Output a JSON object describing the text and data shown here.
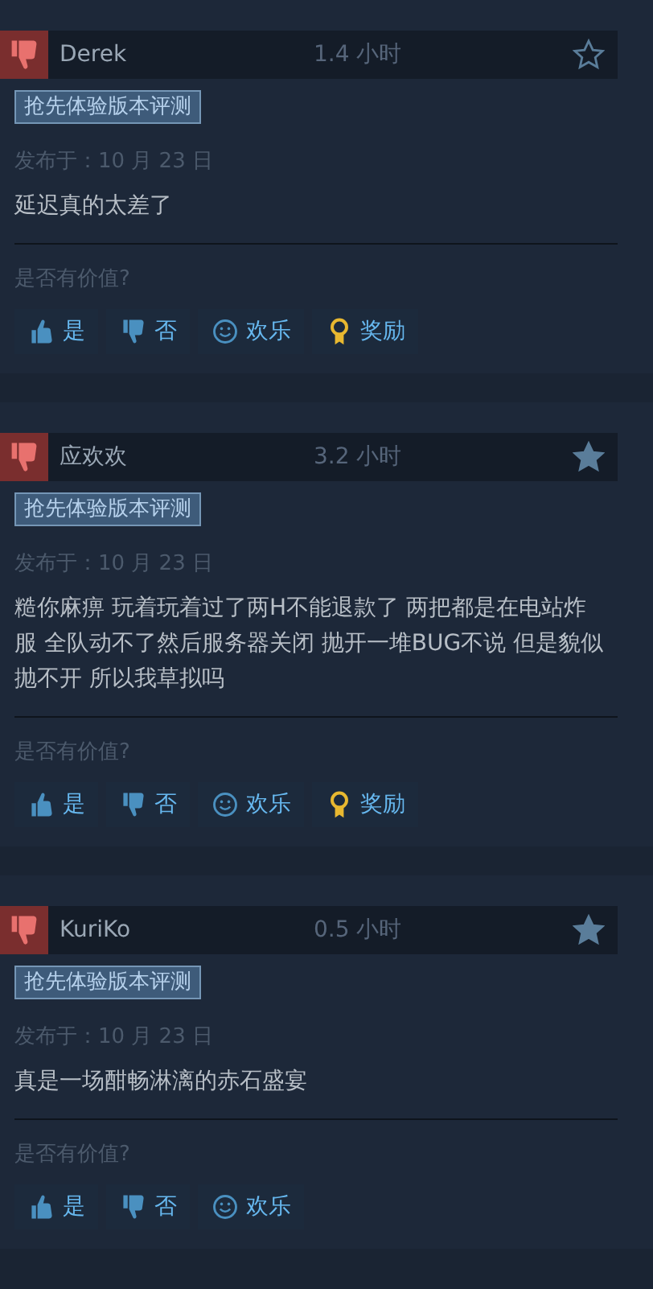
{
  "reviews": [
    {
      "author": "Derek",
      "hours": "1.4 小时",
      "favorited": false,
      "tag": "抢先体验版本评测",
      "posted": "发布于：10 月 23 日",
      "text": "延迟真的太差了",
      "helpful_prompt": "是否有价值?",
      "buttons": [
        {
          "kind": "yes",
          "label": "是"
        },
        {
          "kind": "no",
          "label": "否"
        },
        {
          "kind": "funny",
          "label": "欢乐"
        },
        {
          "kind": "award",
          "label": "奖励"
        }
      ]
    },
    {
      "author": "应欢欢",
      "hours": "3.2 小时",
      "favorited": true,
      "tag": "抢先体验版本评测",
      "posted": "发布于：10 月 23 日",
      "text": "糙你麻痹 玩着玩着过了两H不能退款了 两把都是在电站炸服 全队动不了然后服务器关闭 抛开一堆BUG不说 但是貌似抛不开 所以我草拟吗",
      "helpful_prompt": "是否有价值?",
      "buttons": [
        {
          "kind": "yes",
          "label": "是"
        },
        {
          "kind": "no",
          "label": "否"
        },
        {
          "kind": "funny",
          "label": "欢乐"
        },
        {
          "kind": "award",
          "label": "奖励"
        }
      ]
    },
    {
      "author": "KuriKo",
      "hours": "0.5 小时",
      "favorited": true,
      "tag": "抢先体验版本评测",
      "posted": "发布于：10 月 23 日",
      "text": "真是一场酣畅淋漓的赤石盛宴",
      "helpful_prompt": "是否有价值?",
      "buttons": [
        {
          "kind": "yes",
          "label": "是"
        },
        {
          "kind": "no",
          "label": "否"
        },
        {
          "kind": "funny",
          "label": "欢乐"
        }
      ]
    }
  ]
}
